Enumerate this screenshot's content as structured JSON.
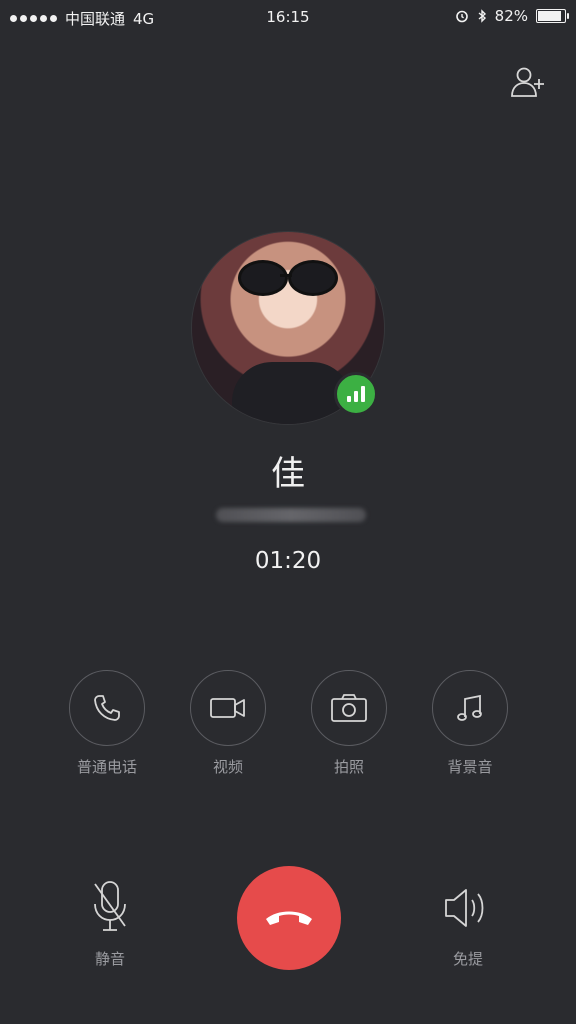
{
  "status_bar": {
    "carrier": "中国联通",
    "network": "4G",
    "time": "16:15",
    "battery": "82%",
    "battery_level": 0.82
  },
  "contact": {
    "name": "佳",
    "duration": "01:20"
  },
  "actions": [
    {
      "label": "普通电话",
      "icon": "phone-icon"
    },
    {
      "label": "视频",
      "icon": "video-icon"
    },
    {
      "label": "拍照",
      "icon": "camera-icon"
    },
    {
      "label": "背景音",
      "icon": "music-icon"
    }
  ],
  "bottom": {
    "mute_label": "静音",
    "speaker_label": "免提"
  },
  "colors": {
    "background": "#2a2b2f",
    "hangup": "#e64b4b",
    "signal_badge": "#3cb043"
  }
}
